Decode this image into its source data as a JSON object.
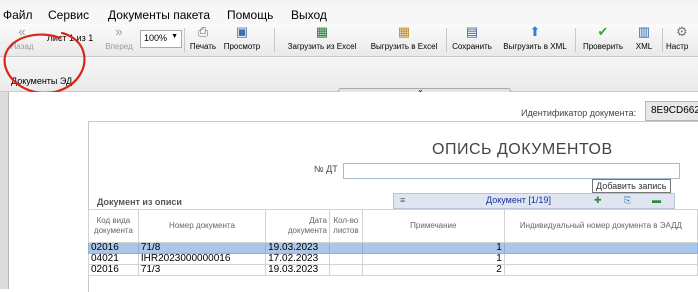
{
  "menu": {
    "items": [
      "Файл",
      "Сервис",
      "Документы пакета",
      "Помощь",
      "Выход"
    ]
  },
  "toolbar": {
    "back_label": "Назад",
    "page_indicator": "Лист 1 из 1",
    "forward_label": "Вперед",
    "zoom_value": "100%",
    "print_label": "Печать",
    "preview_label": "Просмотр",
    "load_excel_label": "Загрузить из Excel",
    "export_excel_label": "Выгрузить в Excel",
    "save_label": "Сохранить",
    "export_xml_label": "Выгрузить в XML",
    "check_label": "Проверить",
    "xml_label": "XML",
    "settings_label": "Настр"
  },
  "panel": {
    "tab_label": "Документы ЭД"
  },
  "document": {
    "id_label": "Идентификатор документа:",
    "id_value": "8E9CD662",
    "title": "ОПИСЬ ДОКУМЕНТОВ",
    "dt_label": "№ ДТ",
    "dt_value": "",
    "tooltip": "Добавить запись",
    "section_title": "Документ из описи",
    "nav_label": "Документ [1/19]"
  },
  "table": {
    "columns": [
      "Код вида документа",
      "Номер документа",
      "Дата документа",
      "Кол-во листов",
      "Примечание",
      "Индивидуальный номер документа в ЭАДД"
    ],
    "rows": [
      {
        "code": "02016",
        "number": "71/8",
        "date": "19.03.2023",
        "sheets": "",
        "note": "1",
        "id_num": ""
      },
      {
        "code": "04021",
        "number": "IHR2023000000016",
        "date": "17.02.2023",
        "sheets": "",
        "note": "1",
        "id_num": ""
      },
      {
        "code": "02016",
        "number": "71/3",
        "date": "19.03.2023",
        "sheets": "",
        "note": "2",
        "id_num": ""
      }
    ],
    "selected_row": 0
  },
  "colors": {
    "selection": "#aac6e9",
    "annotation_circle": "#d8261c",
    "nav_text": "#1a2f9a"
  },
  "icons": {
    "back": "chevron-double-left-icon",
    "forward": "chevron-double-right-icon",
    "print": "printer-icon",
    "preview": "preview-icon",
    "load_excel": "excel-import-icon",
    "export_excel": "excel-export-icon",
    "save": "floppy-disk-icon",
    "export_xml": "arrow-up-icon",
    "check": "checkmark-icon",
    "xml": "xml-file-icon"
  }
}
